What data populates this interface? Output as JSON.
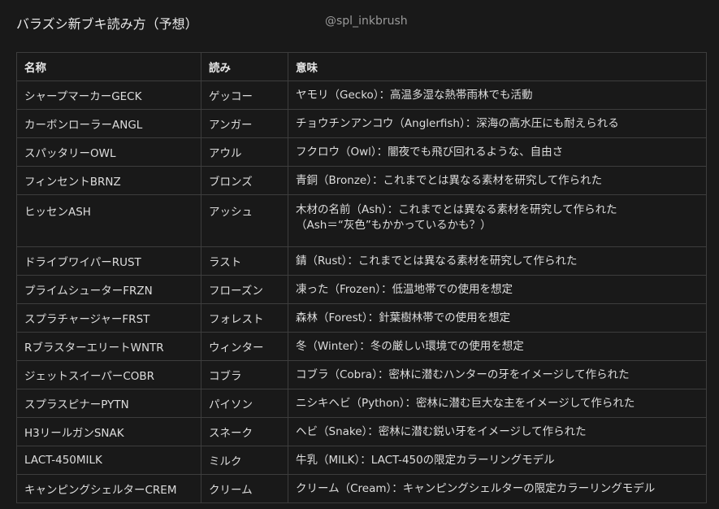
{
  "header": {
    "title": "バラズシ新ブキ読み方（予想）",
    "handle": "@spl_inkbrush"
  },
  "table": {
    "columns": [
      "名称",
      "読み",
      "意味"
    ],
    "rows": [
      {
        "name": "シャープマーカーGECK",
        "reading": "ゲッコー",
        "meaning": [
          "ヤモリ（Gecko）：高温多湿な熱帯雨林でも活動"
        ]
      },
      {
        "name": "カーボンローラーANGL",
        "reading": "アンガー",
        "meaning": [
          "チョウチンアンコウ（Anglerfish）：深海の高水圧にも耐えられる"
        ]
      },
      {
        "name": "スパッタリーOWL",
        "reading": "アウル",
        "meaning": [
          "フクロウ（Owl）：闇夜でも飛び回れるような、自由さ"
        ]
      },
      {
        "name": "フィンセントBRNZ",
        "reading": "ブロンズ",
        "meaning": [
          " 青銅（Bronze）：これまでとは異なる素材を研究して作られた"
        ]
      },
      {
        "name": "ヒッセンASH",
        "reading": "アッシュ",
        "meaning": [
          "木材の名前（Ash）：これまでとは異なる素材を研究して作られた",
          "（Ash＝“灰色”もかかっているかも？）"
        ]
      },
      {
        "name": "ドライブワイパーRUST",
        "reading": "ラスト",
        "meaning": [
          "錆（Rust）：これまでとは異なる素材を研究して作られた"
        ]
      },
      {
        "name": "プライムシューターFRZN",
        "reading": "フローズン",
        "meaning": [
          "凍った（Frozen）：低温地帯での使用を想定"
        ]
      },
      {
        "name": "スプラチャージャーFRST",
        "reading": "フォレスト",
        "meaning": [
          "森林（Forest）：針葉樹林帯での使用を想定"
        ]
      },
      {
        "name": "RブラスターエリートWNTR",
        "reading": "ウィンター",
        "meaning": [
          "冬（Winter）：冬の厳しい環境での使用を想定"
        ]
      },
      {
        "name": "ジェットスイーパーCOBR",
        "reading": "コブラ",
        "meaning": [
          "コブラ（Cobra）：密林に潜むハンターの牙をイメージして作られた"
        ]
      },
      {
        "name": "スプラスピナーPYTN",
        "reading": "パイソン",
        "meaning": [
          "ニシキヘビ（Python）：密林に潜む巨大な主をイメージして作られた"
        ]
      },
      {
        "name": "H3リールガンSNAK",
        "reading": "スネーク",
        "meaning": [
          "ヘビ（Snake）：密林に潜む鋭い牙をイメージして作られた"
        ]
      },
      {
        "name": "LACT-450MILK",
        "reading": "ミルク",
        "meaning": [
          "牛乳（MILK）：LACT-450の限定カラーリングモデル"
        ]
      },
      {
        "name": "キャンピングシェルターCREM",
        "reading": "クリーム",
        "meaning": [
          "クリーム（Cream）：キャンピングシェルターの限定カラーリングモデル"
        ]
      }
    ]
  }
}
